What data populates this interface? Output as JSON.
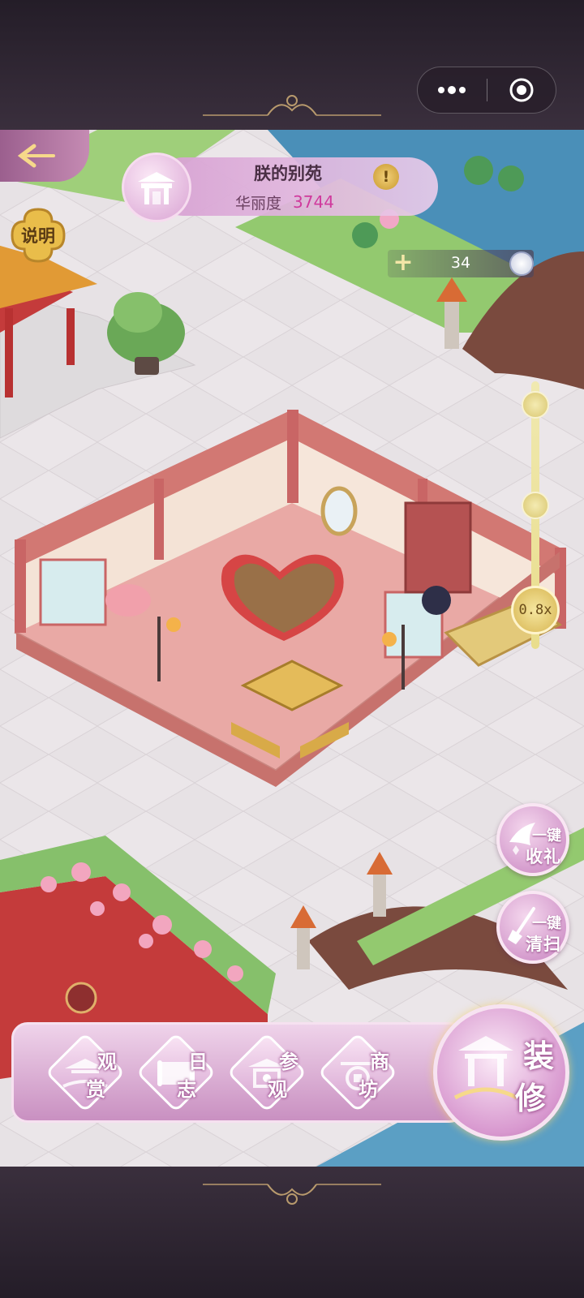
{
  "header": {
    "more_icon": "more-dots-icon",
    "close_icon": "record-close-icon"
  },
  "garden": {
    "title": "朕的别苑",
    "stat_label": "华丽度",
    "stat_value": "3744",
    "hint_icon": "exclamation-icon"
  },
  "info_button": {
    "label": "说明"
  },
  "counter": {
    "value": "34"
  },
  "zoom": {
    "label": "0.8x",
    "level": 0.8
  },
  "quick_actions": [
    {
      "line1": "一键",
      "line2": "收礼",
      "icon": "bird-gift-icon"
    },
    {
      "line1": "一键",
      "line2": "清扫",
      "icon": "broom-icon"
    }
  ],
  "nav": [
    {
      "t1": "观",
      "t2": "赏",
      "icon": "pavilion-icon"
    },
    {
      "t1": "日",
      "t2": "志",
      "icon": "scroll-icon"
    },
    {
      "t1": "参",
      "t2": "观",
      "icon": "visit-icon"
    },
    {
      "t1": "商",
      "t2": "坊",
      "icon": "coin-icon"
    }
  ],
  "decorate_button": {
    "t1": "装",
    "t2": "修",
    "icon": "pavilion-decor-icon"
  },
  "colors": {
    "accent": "#c782bf",
    "stat": "#d03a9d",
    "gold": "#d7b551",
    "floor": "#e9a9a5",
    "wall": "#c86b6b"
  }
}
